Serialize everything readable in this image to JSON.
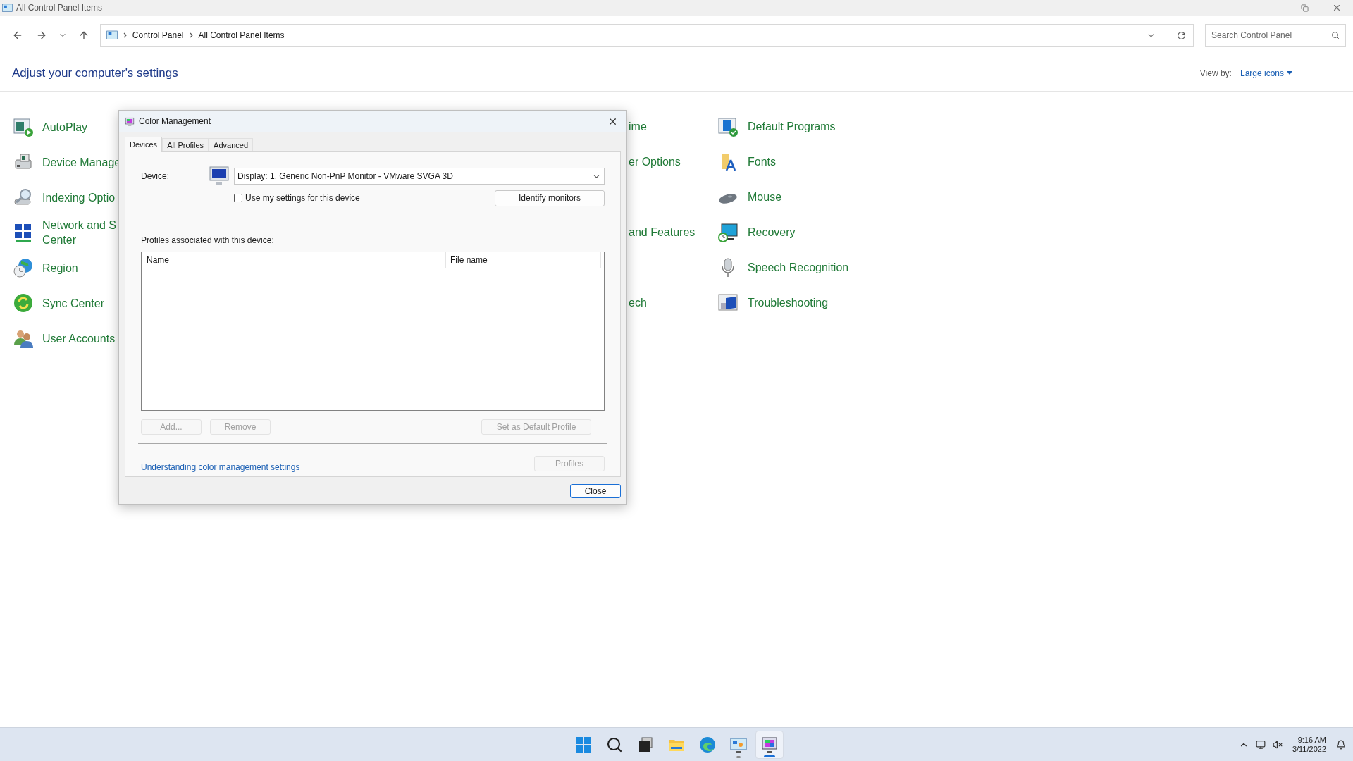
{
  "window": {
    "title": "All Control Panel Items"
  },
  "address_bar": {
    "breadcrumbs": [
      "Control Panel",
      "All Control Panel Items"
    ]
  },
  "search": {
    "placeholder": "Search Control Panel"
  },
  "heading": "Adjust your computer's settings",
  "view_by": {
    "label": "View by:",
    "value": "Large icons"
  },
  "items": [
    {
      "column_1": "AutoPlay",
      "column_2": "ime",
      "column_3": "Default Programs"
    },
    {
      "column_1": "Device Manage",
      "column_2": "er Options",
      "column_3": "Fonts"
    },
    {
      "column_1": "Indexing Optio",
      "column_3": "Mouse"
    },
    {
      "column_1": "Network and S\nCenter",
      "column_2": "and Features",
      "column_3": "Recovery"
    },
    {
      "column_1": "Region",
      "column_3": "Speech Recognition"
    },
    {
      "column_1": "Sync Center",
      "column_2": "ech",
      "column_3": "Troubleshooting"
    },
    {
      "column_1": "User Accounts"
    }
  ],
  "dialog": {
    "title": "Color Management",
    "tabs": [
      {
        "label": "Devices",
        "selected": true
      },
      {
        "label": "All Profiles",
        "selected": false
      },
      {
        "label": "Advanced",
        "selected": false
      }
    ],
    "device_label": "Device:",
    "device_value": "Display: 1. Generic Non-PnP Monitor - VMware SVGA 3D",
    "use_my_settings": {
      "label": "Use my settings for this device",
      "checked": false
    },
    "identify_button": "Identify monitors",
    "profiles_label": "Profiles associated with this device:",
    "columns": [
      "Name",
      "File name"
    ],
    "buttons": [
      {
        "label": "Add...",
        "disabled": true
      },
      {
        "label": "Remove",
        "disabled": true
      },
      {
        "label": "Set as Default Profile",
        "disabled": true
      }
    ],
    "link": "Understanding color management settings",
    "profiles_button": {
      "label": "Profiles",
      "disabled": true
    },
    "close_button": "Close"
  },
  "taskbar": {
    "apps": [
      {
        "running": false,
        "selected": false
      },
      {
        "running": false,
        "selected": false
      },
      {
        "running": false,
        "selected": false
      },
      {
        "running": false,
        "selected": false
      },
      {
        "running": false,
        "selected": false
      },
      {
        "running": true,
        "selected": false
      },
      {
        "running": true,
        "selected": true
      }
    ],
    "clock": {
      "time": "9:16 AM",
      "date": "3/11/2022"
    }
  }
}
